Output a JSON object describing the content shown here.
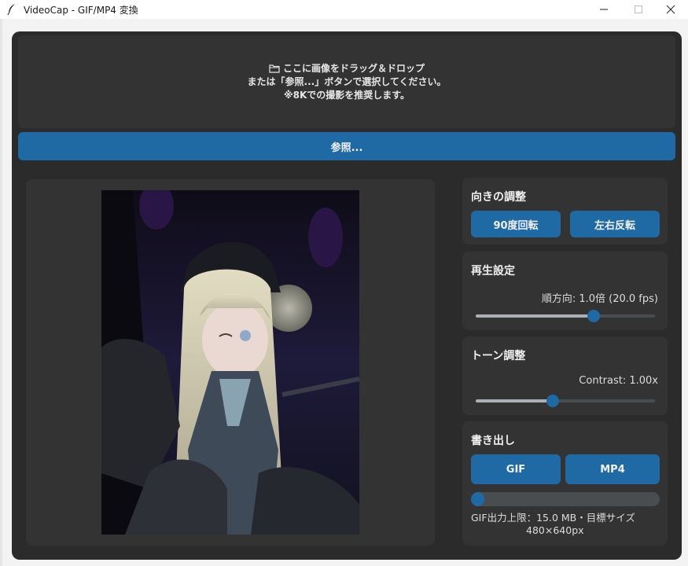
{
  "window": {
    "title": "VideoCap - GIF/MP4 変換",
    "icon": "feather-icon"
  },
  "dropzone": {
    "icon": "folder-icon",
    "line1": "ここに画像をドラッグ＆ドロップ",
    "line2": "または「参照...」ボタンで選択してください。",
    "line3": "※8Kでの撮影を推奨します。"
  },
  "browse_button": "参照...",
  "orientation": {
    "title": "向きの調整",
    "rotate_label": "90度回転",
    "flip_label": "左右反転"
  },
  "playback": {
    "title": "再生設定",
    "value_text": "順方向: 1.0倍 (20.0 fps)",
    "slider_fraction": 0.66
  },
  "tone": {
    "title": "トーン調整",
    "value_text": "Contrast: 1.00x",
    "slider_fraction": 0.43
  },
  "export": {
    "title": "書き出し",
    "gif_label": "GIF",
    "mp4_label": "MP4",
    "progress_fraction": 0.04,
    "info_line1": "GIF出力上限：15.0 MB・目標サイズ",
    "info_line2": "480×640px"
  },
  "colors": {
    "accent": "#1f6aa5",
    "panel": "#333333",
    "background": "#2b2b2b"
  }
}
